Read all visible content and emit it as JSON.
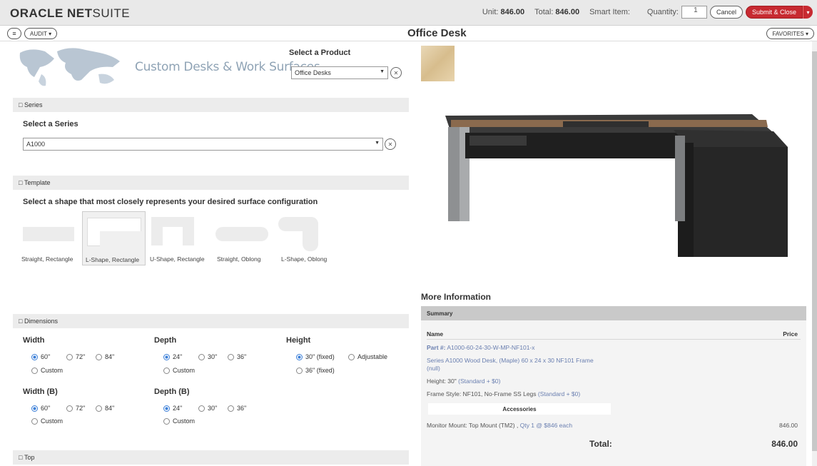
{
  "header": {
    "logo_oracle": "ORACLE",
    "logo_net": "NET",
    "logo_suite": "SUITE",
    "unit_label": "Unit:",
    "unit_value": "846.00",
    "total_label": "Total:",
    "total_value": "846.00",
    "smart_item_label": "Smart Item:",
    "quantity_label": "Quantity:",
    "quantity_value": "1",
    "cancel_label": "Cancel",
    "submit_label": "Submit & Close"
  },
  "subbar": {
    "menu_icon": "≡",
    "audit_label": "AUDIT ▾",
    "page_title": "Office Desk",
    "favorites_label": "FAVORITES ▾"
  },
  "product": {
    "brand_title": "Custom Desks & Work Surfaces",
    "select_label": "Select a Product",
    "selected_product": "Office Desks"
  },
  "series": {
    "section_label": "Series",
    "select_label": "Select a Series",
    "selected_series": "A1000"
  },
  "template": {
    "section_label": "Template",
    "prompt": "Select a shape that most closely represents your desired surface configuration",
    "shapes": [
      "Straight, Rectangle",
      "L-Shape, Rectangle",
      "U-Shape, Rectangle",
      "Straight, Oblong",
      "L-Shape, Oblong"
    ],
    "selected_shape": "L-Shape, Rectangle"
  },
  "dimensions": {
    "section_label": "Dimensions",
    "width_label": "Width",
    "width_options": [
      "60\"",
      "72\"",
      "84\"",
      "Custom"
    ],
    "depth_label": "Depth",
    "depth_options": [
      "24\"",
      "30\"",
      "36\"",
      "Custom"
    ],
    "height_label": "Height",
    "height_options": [
      "30\" (fixed)",
      "Adjustable",
      "36\" (fixed)"
    ],
    "width_b_label": "Width (B)",
    "width_b_options": [
      "60\"",
      "72\"",
      "84\"",
      "Custom"
    ],
    "depth_b_label": "Depth (B)",
    "depth_b_options": [
      "24\"",
      "30\"",
      "36\"",
      "Custom"
    ]
  },
  "top": {
    "section_label": "Top"
  },
  "info": {
    "more_info_label": "More Information",
    "summary_label": "Summary",
    "name_header": "Name",
    "price_header": "Price",
    "part_label": "Part #:",
    "part_value": "A1000-60-24-30-W-MP-NF101-x",
    "series_line_1": "Series A1000 Wood Desk, (Maple) 60 x 24 x 30 NF101 Frame",
    "series_line_2": "(null)",
    "height_line": "Height: 30\"",
    "height_extra": "(Standard + $0)",
    "frame_line": "Frame Style: NF101, No-Frame SS Legs",
    "frame_extra": "(Standard + $0)",
    "accessories_label": "Accessories",
    "monitor_line": "Monitor Mount:  Top Mount (TM2) ,",
    "monitor_extra": "Qty 1 @ $846 each",
    "monitor_price": "846.00",
    "total_label": "Total:",
    "total_value": "846.00"
  }
}
